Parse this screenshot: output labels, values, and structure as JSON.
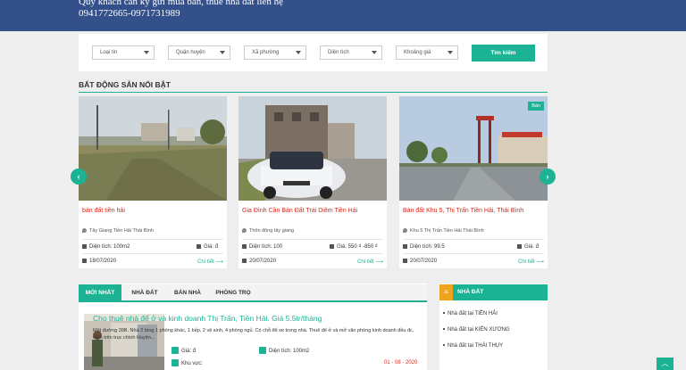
{
  "header": {
    "line1": "Quý khách cần ký gửi mua bán, thuê nhà đất liên hệ",
    "line2": "0941772665-0971731989"
  },
  "search": {
    "filters": [
      "Loại tin",
      "Quận huyện",
      "Xã phường",
      "Diện tích",
      "Khoảng giá"
    ],
    "button": "Tìm kiếm"
  },
  "featured": {
    "title": "BẤT ĐỘNG SẢN NỔI BẬT",
    "cards": [
      {
        "title": "bán đất tiền hải",
        "address": "Tây Giang Tiền Hải Thái Bình",
        "area": "Diện tích: 100m2",
        "price": "Giá: đ",
        "date": "18/07/2020",
        "detail": "Chi tiết ⟶",
        "badge": ""
      },
      {
        "title": "Gia Đình Cần Bán Đất Trái Diêm Tiền Hải",
        "address": "Thôn đông tây giang",
        "area": "Diện tích: 100",
        "price": "Giá: 550 ₫ -850 ₫",
        "date": "20/07/2020",
        "detail": "Chi tiết ⟶",
        "badge": ""
      },
      {
        "title": "Bán đất Khu 5, Thị Trấn Tiền Hải, Thái Bình",
        "address": "Khu 5 Thị Trấn Tiền Hải Thái Bình",
        "area": "Diện tích: 99.5",
        "price": "Giá: đ",
        "date": "20/07/2020",
        "detail": "Chi tiết ⟶",
        "badge": "Bán"
      }
    ]
  },
  "tabs": [
    "MỚI NHẤT",
    "NHÀ ĐẤT",
    "BÁN NHÀ",
    "PHÒNG TRỌ"
  ],
  "post": {
    "title": "Cho thuê nhà để ở và kinh doanh Thị Trấn, Tiền Hải. Giá 5.5tr/tháng",
    "desc": "Mặt đường 39B. Nhà 2 tầng 1 phòng khác, 1 bếp, 2 vệ sinh, 4 phòng ngủ. Có chỗ để xe trong nhà. Thuê để ở và mở văn phòng kinh doanh đều đc, nằm trên trục chính Huyện...",
    "price": "Giá: đ",
    "area": "Diện tích: 100m2",
    "region": "Khu vực:",
    "date": "01 - 08 - 2020"
  },
  "sidebar": {
    "title": "NHÀ ĐẤT",
    "items": [
      "Nhà đất tại TIỀN HẢI",
      "Nhà đất tại KIẾN XƯƠNG",
      "Nhà đất tại THÁI THỤY"
    ]
  }
}
